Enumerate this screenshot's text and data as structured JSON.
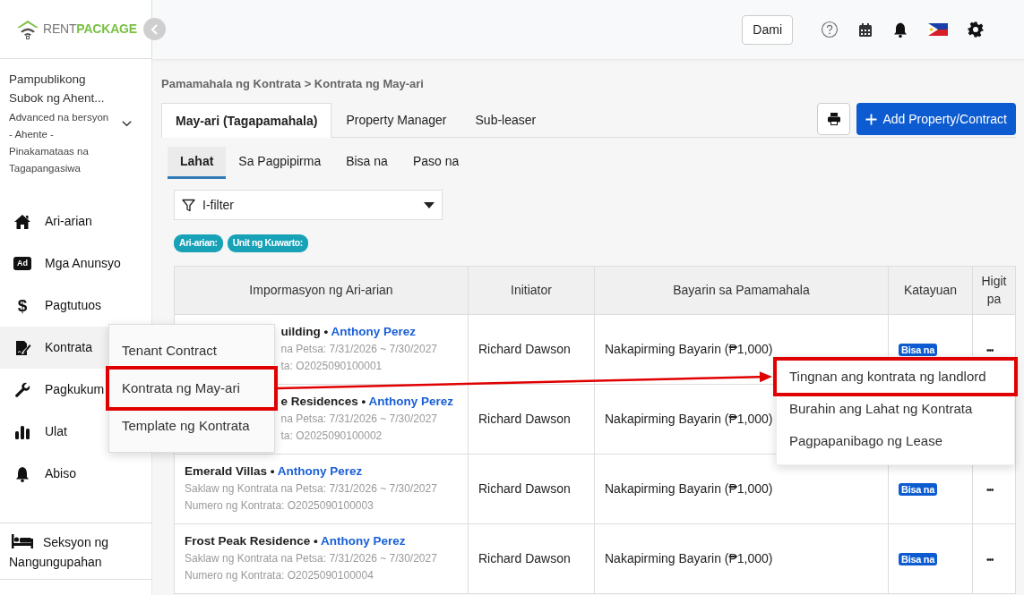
{
  "logo": {
    "text_a": "RENT",
    "text_b": "PACKAGE"
  },
  "topbar": {
    "user_button": "Dami"
  },
  "account": {
    "name": "Pampublikong Subok ng Ahent...",
    "plan": "Advanced na bersyon - Ahente - Pinakamataas na Tagapangasiwa"
  },
  "sidebar": {
    "items": [
      {
        "label": "Ari-arian",
        "selected": false
      },
      {
        "label": "Mga Anunsyo",
        "icon_text": "Ad",
        "selected": false
      },
      {
        "label": "Pagtutuos",
        "icon_text": "$",
        "selected": false
      },
      {
        "label": "Kontrata",
        "selected": true
      },
      {
        "label": "Pagkukum",
        "selected": false
      },
      {
        "label": "Ulat",
        "selected": false
      },
      {
        "label": "Abiso",
        "selected": false
      }
    ],
    "footer": "Seksyon ng Nangungupahan"
  },
  "flyout_menu": {
    "items": [
      {
        "label": "Tenant Contract",
        "highlighted": false
      },
      {
        "label": "Kontrata ng May-ari",
        "highlighted": true
      },
      {
        "label": "Template ng Kontrata",
        "highlighted": false
      }
    ]
  },
  "breadcrumb": "Pamamahala ng Kontrata > Kontrata ng May-ari",
  "tabs": [
    {
      "label": "May-ari (Tagapamahala)",
      "selected": true
    },
    {
      "label": "Property Manager",
      "selected": false
    },
    {
      "label": "Sub-leaser",
      "selected": false
    }
  ],
  "add_button": "Add Property/Contract",
  "subtabs": [
    {
      "label": "Lahat",
      "selected": true
    },
    {
      "label": "Sa Pagpipirma",
      "selected": false
    },
    {
      "label": "Bisa na",
      "selected": false
    },
    {
      "label": "Paso na",
      "selected": false
    }
  ],
  "filter": {
    "placeholder": "I-filter"
  },
  "filter_tags": [
    "Ari-arian:",
    "Unit ng Kuwarto:"
  ],
  "table": {
    "columns": [
      "Impormasyon ng Ari-arian",
      "Initiator",
      "Bayarin sa Pamamahala",
      "Katayuan",
      "Higit pa"
    ],
    "rows": [
      {
        "property": "uilding •",
        "agent": "Anthony Perez",
        "date_range": "na Petsa: 7/31/2026 ~ 7/30/2027",
        "contract_no": "ta: O2025090100001",
        "initiator": "Richard Dawson",
        "fee": "Nakapirming Bayarin (₱1,000)",
        "status": "Bisa na",
        "more": "•••"
      },
      {
        "property": "e Residences •",
        "agent": "Anthony Perez",
        "date_range": "na Petsa: 7/31/2026 ~ 7/30/2027",
        "contract_no": "ta: O2025090100002",
        "initiator": "Richard Dawson",
        "fee": "Nakapirming Bayarin (₱1,000)"
      },
      {
        "property": "Emerald Villas •",
        "agent": "Anthony Perez",
        "date_range": "Saklaw ng Kontrata na Petsa: 7/31/2026 ~ 7/30/2027",
        "contract_no": "Numero ng Kontrata: O2025090100003",
        "initiator": "Richard Dawson",
        "fee": "Nakapirming Bayarin (₱1,000)",
        "status": "Bisa na",
        "more": "•••"
      },
      {
        "property": "Frost Peak Residence •",
        "agent": "Anthony Perez",
        "date_range": "Saklaw ng Kontrata na Petsa: 7/31/2026 ~ 7/30/2027",
        "contract_no": "Numero ng Kontrata: O2025090100004",
        "initiator": "Richard Dawson",
        "fee": "Nakapirming Bayarin (₱1,000)",
        "status": "Bisa na",
        "more": "•••"
      }
    ]
  },
  "row_menu": {
    "items": [
      {
        "label": "Tingnan ang kontrata ng landlord",
        "highlighted": true
      },
      {
        "label": "Burahin ang Lahat ng Kontrata",
        "highlighted": false
      },
      {
        "label": "Pagpapanibago ng Lease",
        "highlighted": false
      }
    ]
  }
}
